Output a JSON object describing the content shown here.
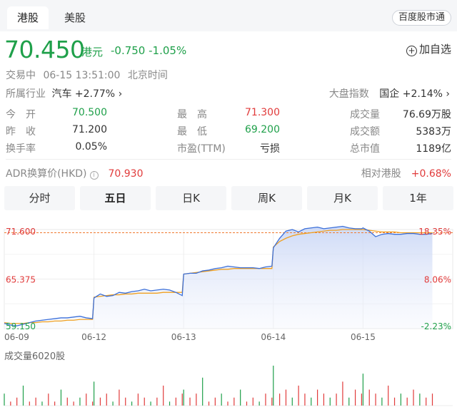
{
  "tabs": [
    {
      "label": "港股",
      "active": true
    },
    {
      "label": "美股",
      "active": false
    }
  ],
  "source_badge": "百度股市通",
  "quote": {
    "price": "70.450",
    "currency": "港元",
    "change": "-0.750",
    "change_pct": "-1.05%",
    "add_watch": "加自选"
  },
  "status": {
    "state": "交易中",
    "time": "06-15 13:51:00",
    "tz": "北京时间"
  },
  "industry": {
    "label": "所属行业",
    "name": "汽车",
    "value": "+2.77%"
  },
  "index": {
    "label": "大盘指数",
    "name": "国企",
    "value": "+2.14%"
  },
  "stats": [
    {
      "label": "今　开",
      "value": "70.500",
      "color": "green"
    },
    {
      "label": "最　高",
      "value": "71.300",
      "color": "red"
    },
    {
      "label": "成交量",
      "value": "76.69万股",
      "color": "plain"
    },
    {
      "label": "昨　收",
      "value": "71.200",
      "color": "plain"
    },
    {
      "label": "最　低",
      "value": "69.200",
      "color": "green"
    },
    {
      "label": "成交额",
      "value": "5383万",
      "color": "plain"
    },
    {
      "label": "换手率",
      "value": "0.05%",
      "color": "plain"
    },
    {
      "label": "市盈(TTM)",
      "value": "亏损",
      "color": "plain"
    },
    {
      "label": "总市值",
      "value": "1189亿",
      "color": "plain"
    }
  ],
  "adr": {
    "label": "ADR换算价(HKD)",
    "value": "70.930"
  },
  "relative": {
    "label": "相对港股",
    "value": "+0.68%"
  },
  "period_tabs": [
    {
      "label": "分时",
      "active": false
    },
    {
      "label": "五日",
      "active": true
    },
    {
      "label": "日K",
      "active": false
    },
    {
      "label": "周K",
      "active": false
    },
    {
      "label": "月K",
      "active": false
    },
    {
      "label": "1年",
      "active": false
    }
  ],
  "volume_label": "成交量6020股",
  "colors": {
    "up": "#e13b3b",
    "down": "#1fa04a",
    "price_line": "#3b6fd9",
    "avg_line": "#f0a020",
    "ref_line": "#f07a30"
  },
  "chart_data": {
    "type": "line",
    "x": [
      "06-09",
      "06-12",
      "06-13",
      "06-14",
      "06-15"
    ],
    "ylim": [
      59.15,
      71.6
    ],
    "y_ticks_left": [
      "71.600",
      "65.375",
      "59.150"
    ],
    "y_ticks_right": [
      "18.35%",
      "8.06%",
      "-2.23%"
    ],
    "reference_line": 71.2,
    "series": [
      {
        "role": "price",
        "days": [
          [
            59.8,
            59.6,
            59.5,
            59.7,
            59.9,
            60.1,
            60.2,
            60.3,
            60.4,
            60.5,
            60.5,
            60.6,
            60.7,
            60.5,
            60.4
          ],
          [
            63.0,
            63.5,
            63.2,
            63.3,
            63.7,
            63.6,
            63.8,
            63.9,
            64.1,
            63.9,
            64.0,
            64.1,
            64.0,
            63.7,
            63.3
          ],
          [
            66.0,
            66.1,
            66.1,
            66.4,
            66.5,
            66.7,
            66.8,
            67.0,
            66.9,
            66.8,
            66.8,
            66.8,
            66.7,
            66.9,
            67.0
          ],
          [
            69.3,
            70.5,
            71.4,
            71.6,
            71.3,
            71.7,
            71.8,
            71.9,
            71.7,
            71.8,
            71.9,
            72.0,
            71.8,
            71.7,
            71.7
          ],
          [
            71.8,
            71.4,
            70.7,
            71.0,
            71.1,
            71.0,
            71.0,
            71.1,
            71.1,
            71.0,
            71.0,
            71.1,
            71.1,
            71.2,
            71.4
          ]
        ]
      },
      {
        "role": "average",
        "days": [
          [
            59.9,
            59.8,
            59.8,
            59.8,
            59.9,
            59.9,
            60.0,
            60.0,
            60.1,
            60.1,
            60.2,
            60.2,
            60.3,
            60.3,
            60.3
          ],
          [
            63.1,
            63.2,
            63.3,
            63.4,
            63.4,
            63.5,
            63.5,
            63.6,
            63.6,
            63.6,
            63.6,
            63.7,
            63.7,
            63.7,
            63.7
          ],
          [
            66.0,
            66.1,
            66.2,
            66.3,
            66.4,
            66.5,
            66.6,
            66.6,
            66.7,
            66.7,
            66.7,
            66.7,
            66.7,
            66.7,
            66.7
          ],
          [
            69.4,
            70.1,
            70.5,
            70.8,
            71.0,
            71.1,
            71.2,
            71.3,
            71.4,
            71.5,
            71.5,
            71.6,
            71.6,
            71.6,
            71.6
          ],
          [
            71.6,
            71.5,
            71.4,
            71.3,
            71.3,
            71.3,
            71.2,
            71.2,
            71.2,
            71.2,
            71.2,
            71.2,
            71.2,
            71.2,
            71.2
          ]
        ]
      }
    ],
    "volume": {
      "label": "成交量6020股",
      "days": [
        [
          3,
          1,
          2,
          5,
          1,
          2,
          1,
          3,
          1,
          4,
          2,
          1,
          2,
          3,
          1
        ],
        [
          6,
          2,
          3,
          1,
          4,
          2,
          1,
          3,
          2,
          1,
          2,
          5,
          1,
          2,
          3
        ],
        [
          4,
          2,
          3,
          7,
          1,
          2,
          3,
          1,
          2,
          4,
          1,
          2,
          1,
          3,
          2
        ],
        [
          10,
          3,
          4,
          2,
          5,
          3,
          2,
          4,
          3,
          2,
          3,
          6,
          2,
          4,
          3
        ],
        [
          8,
          4,
          3,
          2,
          5,
          2,
          3,
          2,
          4,
          3,
          2,
          3,
          2,
          4,
          3
        ]
      ]
    }
  }
}
